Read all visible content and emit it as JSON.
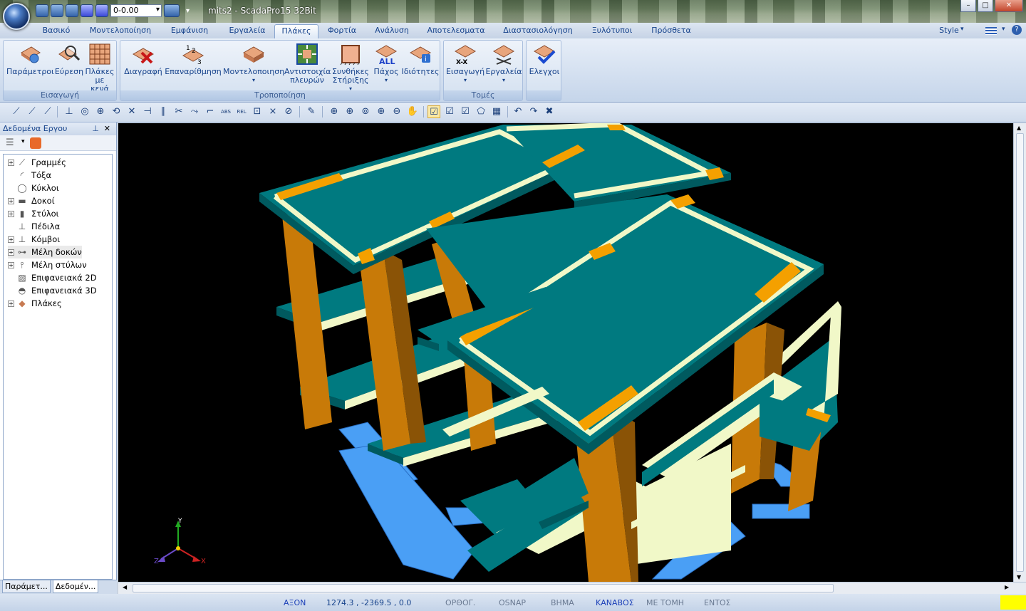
{
  "title_bar": {
    "title": "mits2 - ScadaPro15 32Bit",
    "level_value": "0-0.00",
    "window_buttons": {
      "minimize": "–",
      "maximize": "□",
      "close": "✕"
    }
  },
  "tabs": [
    {
      "label": "Βασικό",
      "active": false
    },
    {
      "label": "Μοντελοποίηση",
      "active": false
    },
    {
      "label": "Εμφάνιση",
      "active": false
    },
    {
      "label": "Εργαλεία",
      "active": false
    },
    {
      "label": "Πλάκες",
      "active": true
    },
    {
      "label": "Φορτία",
      "active": false
    },
    {
      "label": "Ανάλυση",
      "active": false
    },
    {
      "label": "Αποτελεσματα",
      "active": false
    },
    {
      "label": "Διαστασιολόγηση",
      "active": false
    },
    {
      "label": "Ξυλότυποι",
      "active": false
    },
    {
      "label": "Πρόσθετα",
      "active": false
    }
  ],
  "style_menu": {
    "label": "Style"
  },
  "ribbon": {
    "groups": [
      {
        "label": "Εισαγωγή",
        "buttons": [
          "Παράμετροι",
          "Εύρεση",
          "Πλάκες με κενά"
        ]
      },
      {
        "label": "Τροποποίηση",
        "buttons": [
          "Διαγραφή",
          "Επαναρίθμηση",
          "Μοντελοποιηση",
          "Αντιστοιχία πλευρών",
          "Συνθήκες Στήριξης",
          "Πάχος",
          "Ιδιότητες"
        ]
      },
      {
        "label": "Τομές",
        "buttons": [
          "Εισαγωγή",
          "Εργαλεία"
        ]
      },
      {
        "label": "",
        "buttons": [
          "Ελεγχοι"
        ]
      }
    ]
  },
  "panel": {
    "title": "Δεδομένα Εργου",
    "pin": "📌",
    "close": "✕",
    "tree": [
      {
        "label": "Γραμμές",
        "expandable": true,
        "icon": "line-icon"
      },
      {
        "label": "Τόξα",
        "expandable": false,
        "icon": "arc-icon"
      },
      {
        "label": "Κύκλοι",
        "expandable": false,
        "icon": "circle-icon"
      },
      {
        "label": "Δοκοί",
        "expandable": true,
        "icon": "beam-icon"
      },
      {
        "label": "Στύλοι",
        "expandable": true,
        "icon": "column-icon"
      },
      {
        "label": "Πέδιλα",
        "expandable": false,
        "icon": "footing-icon"
      },
      {
        "label": "Κόμβοι",
        "expandable": true,
        "icon": "node-icon"
      },
      {
        "label": "Μέλη δοκών",
        "expandable": true,
        "icon": "beam-member-icon"
      },
      {
        "label": "Μέλη στύλων",
        "expandable": true,
        "icon": "column-member-icon"
      },
      {
        "label": "Επιφανειακά 2D",
        "expandable": false,
        "icon": "surface-2d-icon"
      },
      {
        "label": "Επιφανειακά 3D",
        "expandable": false,
        "icon": "surface-3d-icon"
      },
      {
        "label": "Πλάκες",
        "expandable": true,
        "icon": "slab-icon"
      }
    ],
    "bottom_tabs": [
      "Παράμετ...",
      "Δεδομέν..."
    ]
  },
  "axes": {
    "x": "X",
    "y": "Y",
    "z": "Z"
  },
  "status": {
    "axon": "ΑΞΟΝ",
    "coords": "1274.3 , -2369.5 , 0.0",
    "ortho": "ΟΡΘΟΓ.",
    "osnap": "OSNAP",
    "step": "ΒΗΜΑ",
    "canvas": "ΚΑΝΑΒΟΣ",
    "intersect": "ΜΕ ΤΟΜΗ",
    "within": "ΕΝΤΟΣ"
  },
  "colors": {
    "slab": "#007a80",
    "slab_edge": "#005a5f",
    "beam_light": "#f1f8c8",
    "column": "#c87a08",
    "column_dark": "#8a5306",
    "column_marker": "#f4a000",
    "footing": "#4a9ff5",
    "viewport_bg": "#000000"
  }
}
